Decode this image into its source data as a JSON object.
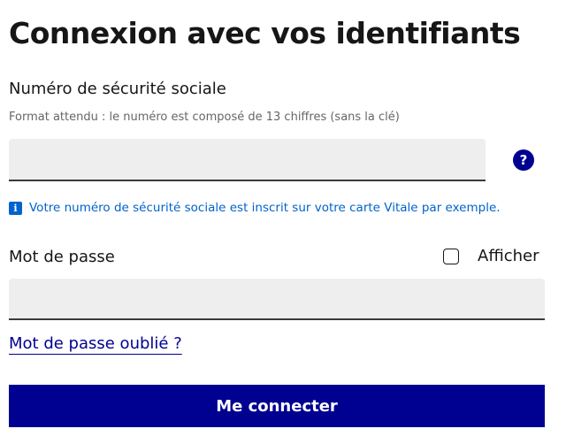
{
  "form": {
    "title": "Connexion avec vos identifiants",
    "nir": {
      "label": "Numéro de sécurité sociale",
      "hint": "Format attendu : le numéro est composé de 13 chiffres (sans la clé)",
      "value": "",
      "help_glyph": "?",
      "info_glyph": "i",
      "info_text": "Votre numéro de sécurité sociale est inscrit sur votre carte Vitale par exemple."
    },
    "password": {
      "label": "Mot de passe",
      "value": "",
      "show_label": "Afficher",
      "show_checked": false
    },
    "forgot_link": "Mot de passe oublié ?",
    "submit_label": "Me connecter"
  },
  "colors": {
    "primary": "#000091",
    "info": "#0063cb",
    "input_bg": "#eeeeee"
  }
}
